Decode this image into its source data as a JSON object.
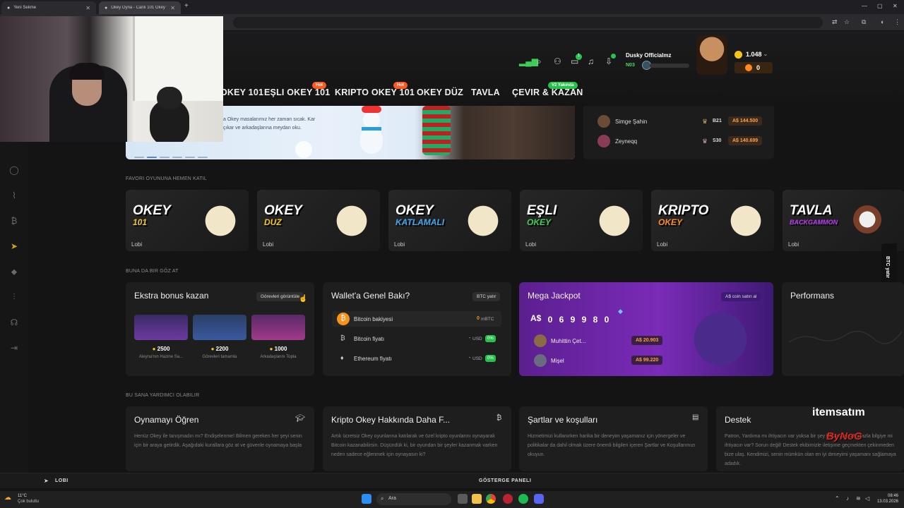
{
  "browser": {
    "tabs": [
      {
        "label": "Yeni Sekme"
      },
      {
        "label": "Okey Oyna - Canlı 101 Okey ve..."
      }
    ]
  },
  "header": {
    "nav": [
      {
        "label": "OKEY 101"
      },
      {
        "label": "EŞLI OKEY 101",
        "badge": "Hot"
      },
      {
        "label": "KRIPTO OKEY 101",
        "badge": "Hot"
      },
      {
        "label": "OKEY DÜZ"
      },
      {
        "label": "TAVLA"
      },
      {
        "label": "ÇEVIR & KAZAN",
        "badge": "V2 Yakında"
      }
    ],
    "notification_count": "1",
    "user": {
      "name": "Dusky Officialmz",
      "level": "N03"
    },
    "balance_coin": "1.048",
    "balance_chip": "0"
  },
  "banner": {
    "line1": "a Okey masalarımız her zaman sıcak. Kar",
    "line2": "çıkar ve arkadaşlarına meydan oku."
  },
  "winners": [
    {
      "name": "Simge Şahin",
      "level": "B21",
      "amount": "A$ 144.500"
    },
    {
      "name": "Zeyneqq",
      "level": "S30",
      "amount": "A$ 140.699"
    }
  ],
  "sections": {
    "favorites": "FAVORI OYUNUNA HEMEN KATIL",
    "look": "BUNA DA BIR GÖZ AT",
    "help": "BU SANA YARDIMCI OLABILIR"
  },
  "games": [
    {
      "title": "OKEY",
      "sub": "101",
      "lobby": "Lobi",
      "color": "#f5c518"
    },
    {
      "title": "OKEY",
      "sub": "DUZ",
      "lobby": "Lobi",
      "color": "#f5c518"
    },
    {
      "title": "OKEY",
      "sub": "KATLAMALI",
      "lobby": "Lobi",
      "color": "#3fa9f5"
    },
    {
      "title": "EŞLI",
      "sub": "OKEY",
      "lobby": "Lobi",
      "color": "#39d353"
    },
    {
      "title": "KRIPTO",
      "sub": "OKEY",
      "lobby": "Lobi",
      "color": "#ff8c1a"
    },
    {
      "title": "TAVLA",
      "sub": "BACKGAMMON",
      "lobby": "Lobi",
      "color": "#c13bff"
    }
  ],
  "bonus_card": {
    "title": "Ekstra bonus kazan",
    "button": "Görevleri görüntüle",
    "items": [
      {
        "value": "2500",
        "desc": "Aleyna'nın Hazine Sa..."
      },
      {
        "value": "2200",
        "desc": "Görevleri tamamla"
      },
      {
        "value": "1000",
        "desc": "Arkadaşlarını Topla"
      }
    ]
  },
  "wallet_card": {
    "title": "Wallet'a Genel Bakı?",
    "button": "BTC yatır",
    "rows": [
      {
        "label": "Bitcoin bakiyesi",
        "value": "0",
        "unit": "mBTC"
      },
      {
        "label": "Bitcoin fiyatı",
        "value": "-",
        "unit": "USD",
        "pct": "0%"
      },
      {
        "label": "Ethereum fiyatı",
        "value": "-",
        "unit": "USD",
        "pct": "0%"
      }
    ]
  },
  "jackpot_card": {
    "title": "Mega Jackpot",
    "button": "A$ coin satın al",
    "currency": "A$",
    "digits": [
      "0",
      "6",
      "9",
      "9",
      "8",
      "0"
    ],
    "winners": [
      {
        "name": "Muhittin Çet...",
        "amount": "A$ 20.903"
      },
      {
        "name": "Mişel",
        "amount": "A$ 99.220"
      }
    ]
  },
  "performance_card": {
    "title": "Performans"
  },
  "side_tab": "BTC yatır",
  "help_cards": [
    {
      "title": "Oynamayı Öğren",
      "text": "Henüz Okey ile tanışmadın mı? Endişelenme! Bilmen gereken her şeyi senin için bir araya getirdik. Aşağıdaki kurallara göz at ve güvenle oynamaya başla"
    },
    {
      "title": "Kripto Okey Hakkında Daha F...",
      "text": "Artık ücretsiz Okey oyunlarına katılarak ve özel kripto oyunlarını oynayarak Bitcoin kazanabilirsin. Düşündük ki, bir oyundan bir şeyler kazanmak varken neden sadece eğlenmek için oynayasın ki?"
    },
    {
      "title": "Şartlar ve koşulları",
      "text": "Hizmetimizi kullanırken harika bir deneyim yaşamanız için yönergeler ve politikalar da dahil olmak üzere önemli bilgileri içeren Şartlar ve Koşullarımızı okuyun."
    },
    {
      "title": "Destek",
      "text": "Patron, Yardıma mı ihtiyacın var yoksa bir şey hakkında daha fazla bilgiye mi ihtiyacın var? Sorun değil! Destek ekibimizle iletişime geçmekten çekinmeden bize ulaş. Kendimizi, senin mümkün olan en iyi deneyimi yaşamanı sağlamaya adadık."
    }
  ],
  "bottom_bar": {
    "lobby": "LOBI",
    "dashboard": "GÖSTERGE PANELI"
  },
  "watermark": {
    "brand": "itemsatım",
    "name": "ByNoG"
  },
  "taskbar": {
    "weather_temp": "11°C",
    "weather_desc": "Çok bulutlu",
    "search": "Ara",
    "time": "08:46",
    "date": "13.03.2026"
  }
}
